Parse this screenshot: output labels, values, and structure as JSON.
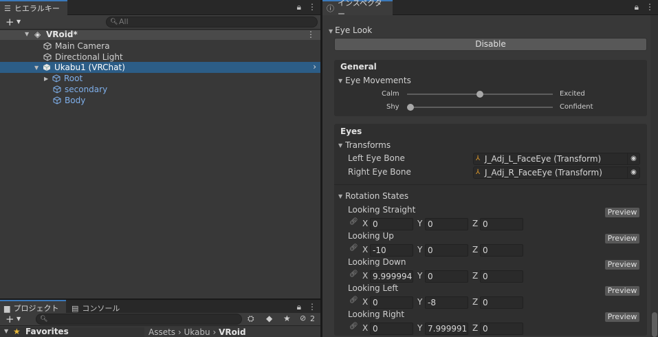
{
  "hierarchy": {
    "tab_label": "ヒエラルキー",
    "search_placeholder": "All",
    "scene_name": "VRoid*",
    "items": [
      {
        "label": "Main Camera"
      },
      {
        "label": "Directional Light"
      },
      {
        "label": "Ukabu1 (VRChat)"
      },
      {
        "label": "Root"
      },
      {
        "label": "secondary"
      },
      {
        "label": "Body"
      }
    ]
  },
  "project": {
    "tab_label": "プロジェクト",
    "console_tab_label": "コンソール",
    "favorites_label": "Favorites",
    "breadcrumb": [
      "Assets",
      "Ukabu",
      "VRoid"
    ],
    "hidden_count": "2"
  },
  "inspector": {
    "tab_label": "インスペクター",
    "component_title": "Eye Look",
    "disable_button": "Disable",
    "general": {
      "title": "General",
      "eye_movements_label": "Eye Movements",
      "calm_label": "Calm",
      "excited_label": "Excited",
      "shy_label": "Shy",
      "confident_label": "Confident",
      "calm_excited_value": 0.5,
      "shy_confident_value": 0.0
    },
    "eyes": {
      "title": "Eyes",
      "transforms_label": "Transforms",
      "left_eye_label": "Left Eye Bone",
      "left_eye_value": "J_Adj_L_FaceEye (Transform)",
      "right_eye_label": "Right Eye Bone",
      "right_eye_value": "J_Adj_R_FaceEye (Transform)",
      "rotation_states_label": "Rotation States",
      "preview_label": "Preview",
      "axis_x": "X",
      "axis_y": "Y",
      "axis_z": "Z",
      "states": [
        {
          "label": "Looking Straight",
          "x": "0",
          "y": "0",
          "z": "0"
        },
        {
          "label": "Looking Up",
          "x": "-10",
          "y": "0",
          "z": "0"
        },
        {
          "label": "Looking Down",
          "x": "9.999994",
          "y": "0",
          "z": "0"
        },
        {
          "label": "Looking Left",
          "x": "0",
          "y": "-8",
          "z": "0"
        },
        {
          "label": "Looking Right",
          "x": "0",
          "y": "7.999991",
          "z": "0"
        }
      ]
    }
  }
}
